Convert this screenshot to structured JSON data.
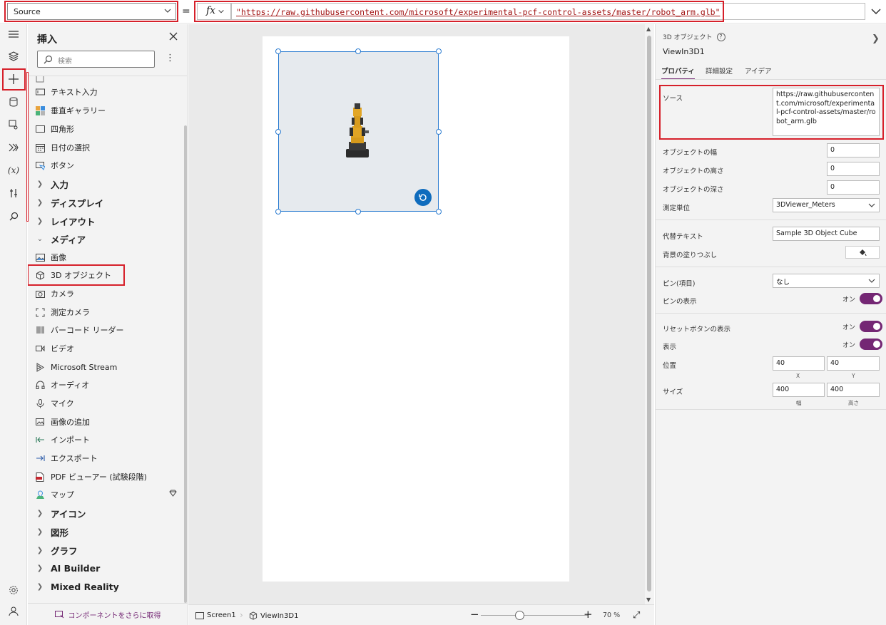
{
  "formula_bar": {
    "property": "Source",
    "equals": "=",
    "fx_label": "fx",
    "formula": "\"https://raw.githubusercontent.com/microsoft/experimental-pcf-control-assets/master/robot_arm.glb\""
  },
  "insert_panel": {
    "title": "挿入",
    "search_placeholder": "検索",
    "items": [
      {
        "label": "テキスト入力",
        "icon": "text-input-icon"
      },
      {
        "label": "垂直ギャラリー",
        "icon": "gallery-icon"
      },
      {
        "label": "四角形",
        "icon": "rectangle-icon"
      },
      {
        "label": "日付の選択",
        "icon": "calendar-icon"
      },
      {
        "label": "ボタン",
        "icon": "button-icon"
      }
    ],
    "categories": [
      {
        "label": "入力"
      },
      {
        "label": "ディスプレイ"
      },
      {
        "label": "レイアウト"
      },
      {
        "label": "メディア"
      }
    ],
    "media_items": [
      {
        "label": "画像",
        "icon": "image-icon"
      },
      {
        "label": "3D オブジェクト",
        "icon": "cube-icon"
      },
      {
        "label": "カメラ",
        "icon": "camera-icon"
      },
      {
        "label": "測定カメラ",
        "icon": "measure-camera-icon"
      },
      {
        "label": "バーコード リーダー",
        "icon": "barcode-icon"
      },
      {
        "label": "ビデオ",
        "icon": "video-icon"
      },
      {
        "label": "Microsoft Stream",
        "icon": "stream-icon"
      },
      {
        "label": "オーディオ",
        "icon": "headphones-icon"
      },
      {
        "label": "マイク",
        "icon": "microphone-icon"
      },
      {
        "label": "画像の追加",
        "icon": "add-picture-icon"
      },
      {
        "label": "インポート",
        "icon": "import-icon"
      },
      {
        "label": "エクスポート",
        "icon": "export-icon"
      },
      {
        "label": "PDF ビューアー (試験段階)",
        "icon": "pdf-icon"
      },
      {
        "label": "マップ",
        "icon": "map-icon"
      }
    ],
    "more_categories": [
      {
        "label": "アイコン"
      },
      {
        "label": "図形"
      },
      {
        "label": "グラフ"
      },
      {
        "label": "AI Builder"
      },
      {
        "label": "Mixed Reality"
      }
    ],
    "get_more": "コンポーネントをさらに取得"
  },
  "status_bar": {
    "screen": "Screen1",
    "control": "ViewIn3D1",
    "zoom": "70 %"
  },
  "properties": {
    "type_label": "3D オブジェクト",
    "control_name": "ViewIn3D1",
    "tabs": [
      "プロパティ",
      "詳細設定",
      "アイデア"
    ],
    "source_label": "ソース",
    "source_value": "https://raw.githubusercontent.com/microsoft/experimental-pcf-control-assets/master/robot_arm.glb",
    "object_width_label": "オブジェクトの幅",
    "object_width": "0",
    "object_height_label": "オブジェクトの高さ",
    "object_height": "0",
    "object_depth_label": "オブジェクトの深さ",
    "object_depth": "0",
    "units_label": "測定単位",
    "units": "3DViewer_Meters",
    "alt_text_label": "代替テキスト",
    "alt_text": "Sample 3D Object Cube",
    "fill_label": "背景の塗りつぶし",
    "pins_label": "ピン(項目)",
    "pins": "なし",
    "show_pins_label": "ピンの表示",
    "show_pins": "オン",
    "show_reset_label": "リセットボタンの表示",
    "show_reset": "オン",
    "visible_label": "表示",
    "visible": "オン",
    "position_label": "位置",
    "pos_x": "40",
    "pos_y": "40",
    "pos_x_sub": "X",
    "pos_y_sub": "Y",
    "size_label": "サイズ",
    "width": "400",
    "height": "400",
    "width_sub": "幅",
    "height_sub": "高さ"
  },
  "colors": {
    "accent": "#742774",
    "highlight": "#d6202a",
    "selection": "#2a7bd0"
  }
}
